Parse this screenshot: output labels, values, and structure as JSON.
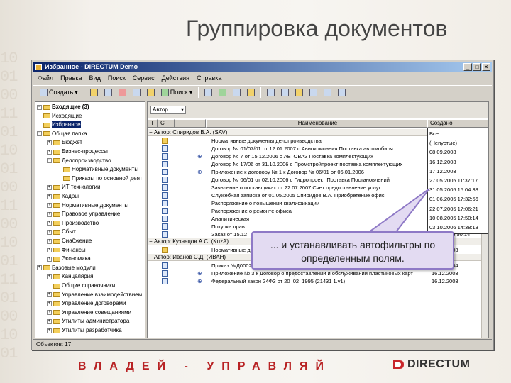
{
  "slide": {
    "title": "Группировка документов",
    "slogan": "ВЛАДЕЙ - УПРАВЛЯЙ",
    "logo_text": "DIRECTUM",
    "binary_bg": "10\n01\n00\n11\n01\n10\n01\n00\n11\n00\n10\n01\n11\n01\n00\n10\n01"
  },
  "app": {
    "title": "Избранное - DIRECTUM Demo",
    "menu": [
      "Файл",
      "Правка",
      "Вид",
      "Поиск",
      "Сервис",
      "Действия",
      "Справка"
    ],
    "toolbar": {
      "create_label": "Создать",
      "search_label": "Поиск"
    },
    "status": "Объектов: 17"
  },
  "tree": [
    {
      "label": "Входящие (3)",
      "bold": true,
      "plus": "-"
    },
    {
      "label": "Исходящие",
      "plus": ""
    },
    {
      "label": "Избранное",
      "plus": "",
      "selected": true
    },
    {
      "label": "Общая папка",
      "plus": "-"
    },
    {
      "label": "Бюджет",
      "plus": "+"
    },
    {
      "label": "Бизнес-процессы",
      "plus": "+"
    },
    {
      "label": "Делопроизводство",
      "plus": "-"
    },
    {
      "label": "Нормативные документы",
      "plus": ""
    },
    {
      "label": "Приказы по основной деят",
      "plus": ""
    },
    {
      "label": "ИТ технологии",
      "plus": "+"
    },
    {
      "label": "Кадры",
      "plus": "+"
    },
    {
      "label": "Нормативные документы",
      "plus": "+"
    },
    {
      "label": "Правовое управление",
      "plus": "+"
    },
    {
      "label": "Производство",
      "plus": "+"
    },
    {
      "label": "Сбыт",
      "plus": "+"
    },
    {
      "label": "Снабжение",
      "plus": "+"
    },
    {
      "label": "Финансы",
      "plus": "+"
    },
    {
      "label": "Экономика",
      "plus": "+"
    },
    {
      "label": "Базовые модули",
      "plus": "+"
    },
    {
      "label": "Канцелярия",
      "plus": "+"
    },
    {
      "label": "Общие справочники",
      "plus": ""
    },
    {
      "label": "Управление взаимодействием",
      "plus": "+"
    },
    {
      "label": "Управление договорами",
      "plus": "+"
    },
    {
      "label": "Управление совещаниями",
      "plus": "+"
    },
    {
      "label": "Утилиты администратора",
      "plus": "+"
    },
    {
      "label": "Утилиты разработчика",
      "plus": "+"
    }
  ],
  "list": {
    "filter_combo": "Автор",
    "columns": [
      "Т",
      "С",
      "",
      "Наименование",
      "Создано"
    ],
    "groups": [
      {
        "label": "Автор: Спиридов В.А. (SAV)",
        "rows": [
          {
            "icon": "folder",
            "link": false,
            "text": "Нормативные документы делопроизводства",
            "date": "08.09.2003"
          },
          {
            "icon": "doc",
            "link": false,
            "text": "Договор № 01/07/01 от 12.01.2007 с Авиокомпания Поставка автомобиля",
            "date": "16.12.2003"
          },
          {
            "icon": "doc",
            "link": true,
            "text": "Договор № 7 от 15.12.2006 с АВТОВАЗ Поставка комплектующих",
            "date": "17.12.2003"
          },
          {
            "icon": "doc",
            "link": false,
            "text": "Договор № 17/06 от 31.10.2006 с Промстройпроект поставка комплектующих",
            "date": "27.05.2005 11:37:17"
          },
          {
            "icon": "doc",
            "link": true,
            "text": "Приложение к договору № 1 к Договор № 06/01 от 06.01.2006",
            "date": "31.05.2005 15:04:38"
          },
          {
            "icon": "doc",
            "link": false,
            "text": "Договор № 06/01 от 02.10.2006 с Гидропроект Поставка Постановлений",
            "date": "31.05.2005 15:04:38"
          },
          {
            "icon": "doc",
            "link": false,
            "text": "Заявление о поставщиках от 22.07.2007 Счет предоставление услуг",
            "date": "01.06.2005 17:32:56"
          },
          {
            "icon": "doc",
            "link": false,
            "text": "Служебная записка от 01.05.2005 Спиридов В.А. Приобретение офис",
            "date": "22.07.2005 17:06:21"
          },
          {
            "icon": "doc",
            "link": false,
            "text": "Распоряжение о повышении квалификации",
            "date": "10.08.2005 17:50:14"
          },
          {
            "icon": "doc",
            "link": false,
            "text": "Распоряжение о ремонте офиса",
            "date": "03.10.2006 14:38:13"
          },
          {
            "icon": "doc",
            "link": false,
            "text": "Аналитическая",
            "date": "...2006 15:04:28"
          },
          {
            "icon": "doc",
            "link": false,
            "text": "Покупка прав",
            "date": "...2006 18:38:16"
          },
          {
            "icon": "doc",
            "link": false,
            "text": "Заказ от 15.12",
            "date": "...2006 15:50:14"
          }
        ]
      },
      {
        "label": "Автор: Кузнецов А.С. (KuzA)",
        "rows": [
          {
            "icon": "folder",
            "link": false,
            "text": "Нормативные документы делопроизводства",
            "date": "08.09.2003"
          }
        ]
      },
      {
        "label": "Автор: Иванов С.Д. (ИВАН)",
        "rows": [
          {
            "icon": "doc",
            "link": false,
            "text": "Приказ №Д0002002 от 01.07.2005 Зачисление в штат",
            "date": "08.01.2004"
          },
          {
            "icon": "doc",
            "link": true,
            "text": "Приложение № 3 к Договор о предоставлении и обслуживании пластиковых карт",
            "date": "16.12.2003"
          },
          {
            "icon": "doc",
            "link": true,
            "text": "Федеральный закон 24ФЗ от 20_02_1995 (21431 1.v1)",
            "date": "16.12.2003"
          }
        ]
      }
    ],
    "filter_popup": [
      "Все",
      "(Непустые)",
      "08.09.2003",
      "16.12.2003",
      "17.12.2003",
      "27.05.2005 11:37:17",
      "31.05.2005 15:04:38",
      "01.06.2005 17:32:56",
      "22.07.2005 17:06:21",
      "10.08.2005 17:50:14",
      "03.10.2006 14:38:13"
    ]
  },
  "callout": {
    "line1": "... и устанавливать автофильтры по",
    "line2": "определенным полям."
  }
}
